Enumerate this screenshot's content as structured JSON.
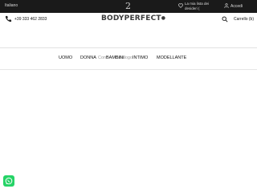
{
  "topbar": {
    "language": "Italiano",
    "center_glyph": "2",
    "wishlist_label": "La mia lista dei desideri (",
    "login_label": "Accedi"
  },
  "header": {
    "phone": "+39 333 462 2833",
    "logo": "BODYPERFECT",
    "cart_label": "Carrello (b)"
  },
  "nav": {
    "items": [
      "UOMO",
      "DONNA",
      "BAMBINI",
      "INTIMO",
      "MODELLANTE"
    ],
    "faint_overlap": [
      "Cont",
      "Catalogo"
    ]
  },
  "colors": {
    "topbar_bg": "#1a1a1a",
    "whatsapp": "#25d366"
  }
}
